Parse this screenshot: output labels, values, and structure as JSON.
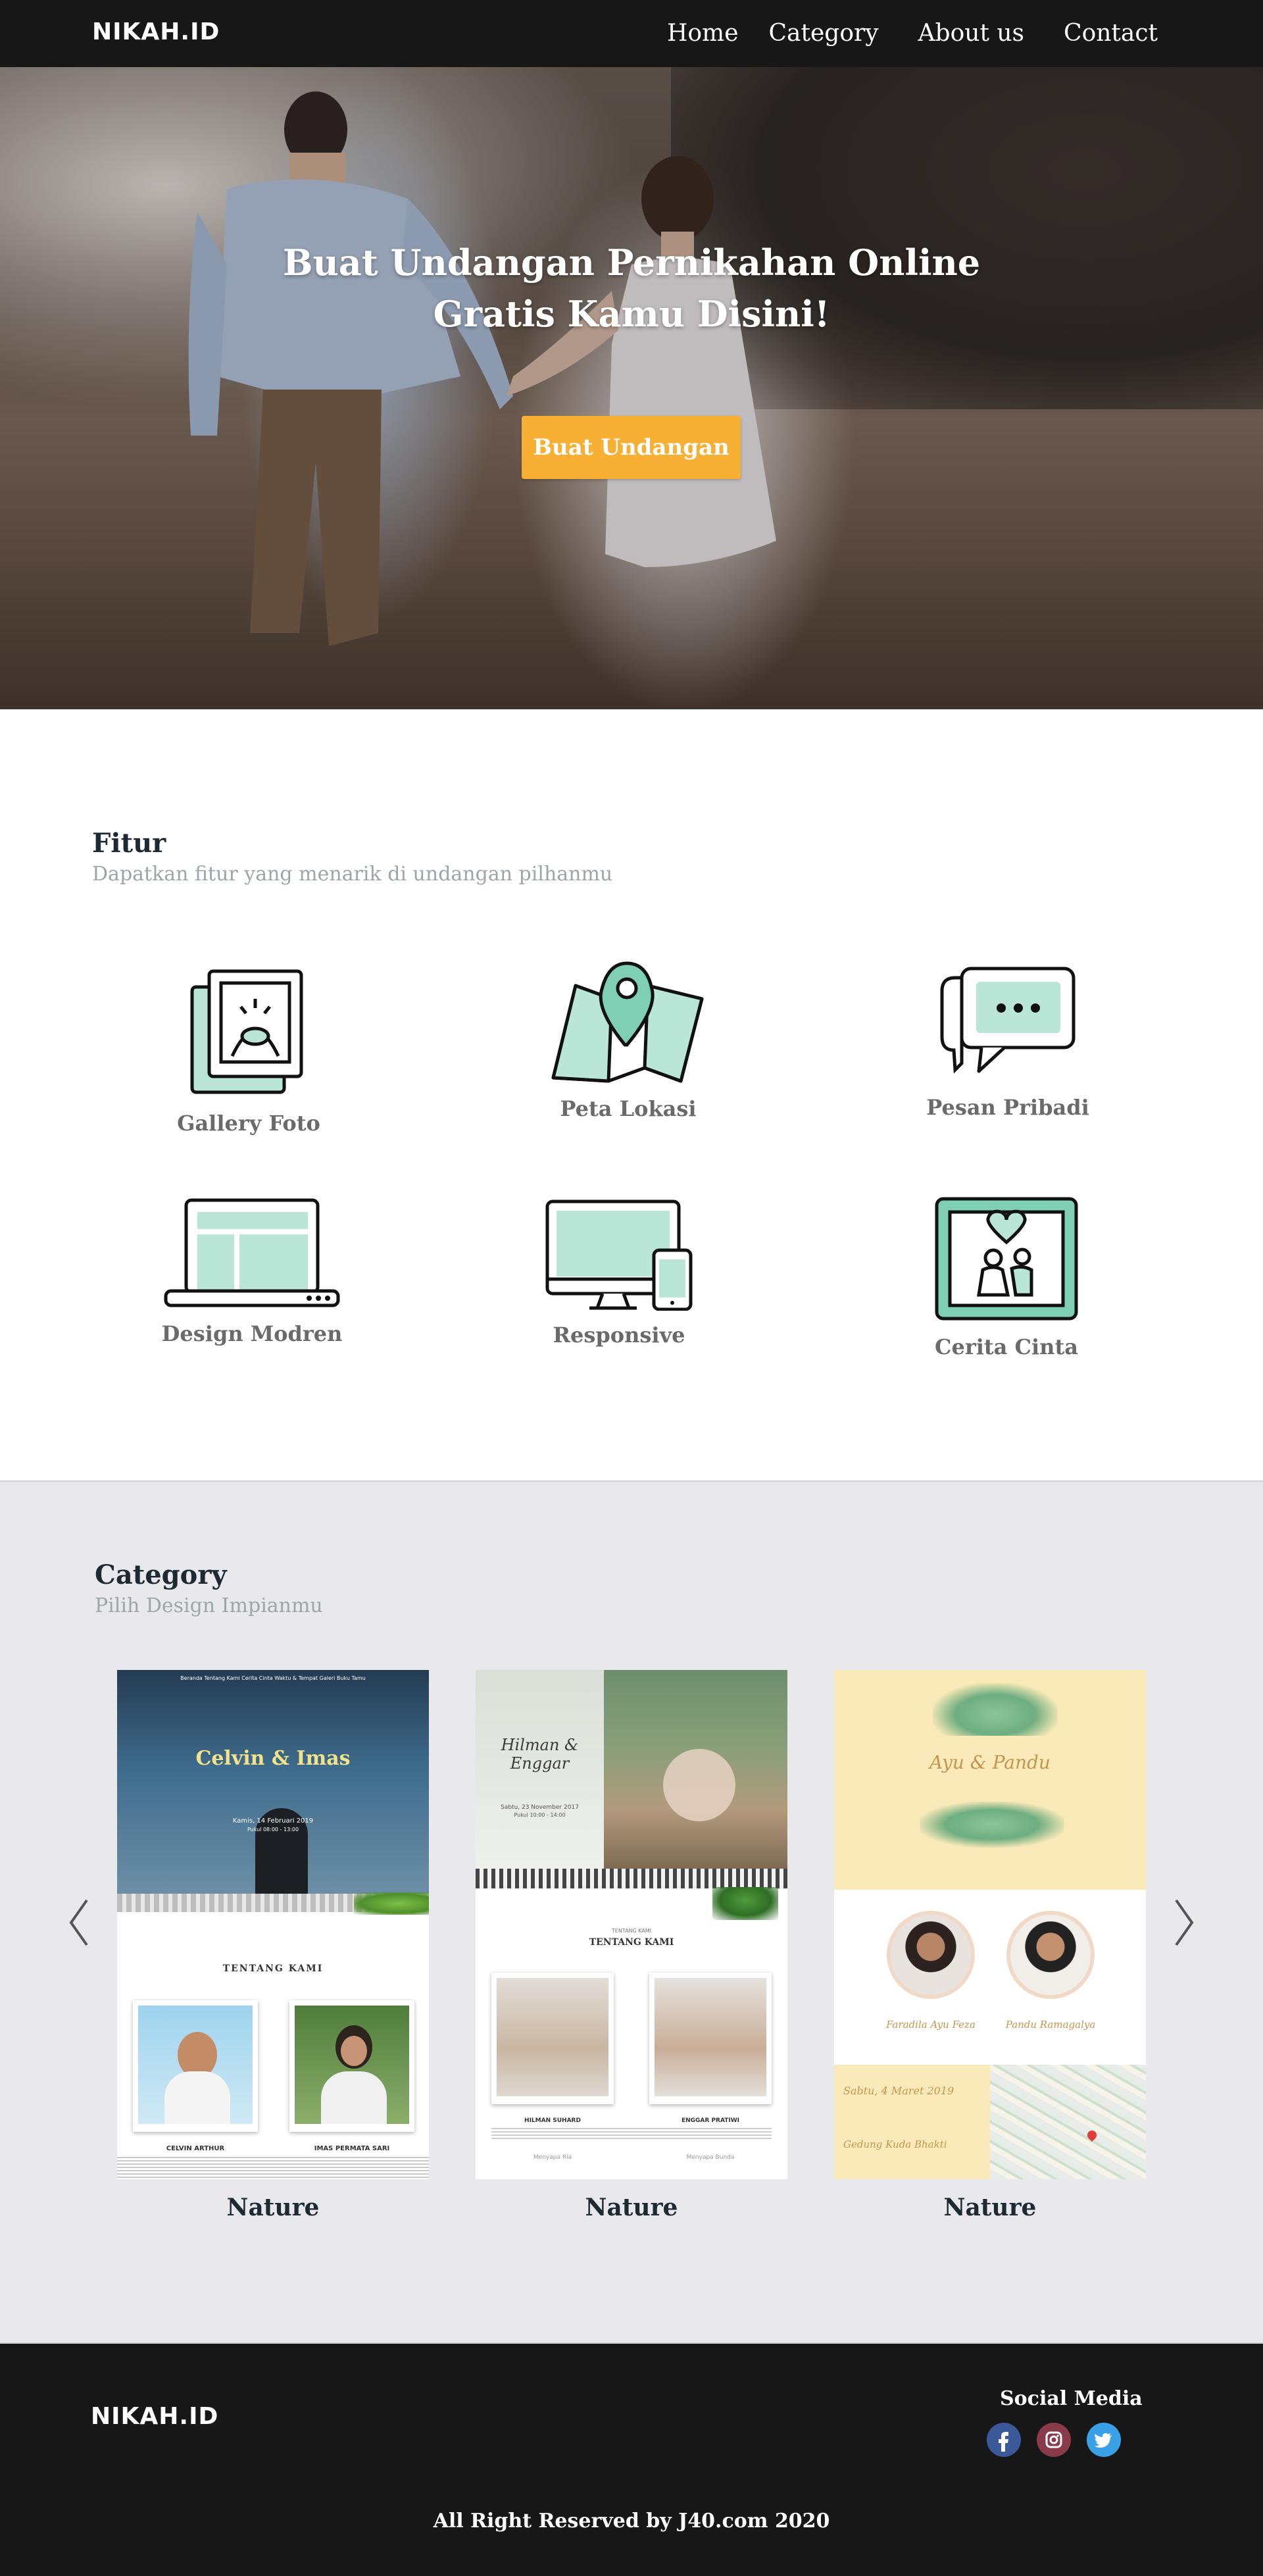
{
  "navbar": {
    "brand": "NIKAH.ID",
    "links": [
      "Home",
      "Category",
      "About us",
      "Contact"
    ]
  },
  "hero": {
    "title_line1": "Buat Undangan Pernikahan Online",
    "title_line2": "Gratis Kamu Disini!",
    "button": "Buat Undangan"
  },
  "fitur": {
    "title": "Fitur",
    "subtitle": "Dapatkan fitur yang menarik di undangan pilhanmu",
    "items": [
      {
        "label": "Gallery Foto",
        "icon": "gallery-photo-icon"
      },
      {
        "label": "Peta Lokasi",
        "icon": "map-location-icon"
      },
      {
        "label": "Pesan Pribadi",
        "icon": "chat-message-icon"
      },
      {
        "label": "Design Modren",
        "icon": "laptop-design-icon"
      },
      {
        "label": "Responsive",
        "icon": "devices-responsive-icon"
      },
      {
        "label": "Cerita Cinta",
        "icon": "love-story-icon"
      }
    ]
  },
  "category": {
    "title": "Category",
    "subtitle": "Pilih Design Impianmu",
    "cards": [
      {
        "label": "Nature",
        "nav": "Beranda   Tentang Kami   Cerita Cinta   Waktu & Tempat   Galeri   Buku Tamu",
        "names": "Celvin & Imas",
        "date": "Kamis, 14 Februari 2019",
        "time": "Pukul 08:00 - 13:00",
        "section": "TENTANG KAMI",
        "person1": "CELVIN ARTHUR",
        "person2": "IMAS PERMATA SARI"
      },
      {
        "label": "Nature",
        "names": "Hilman & Enggar",
        "date": "Sabtu, 23 November 2017",
        "time": "Pukul 10:00 - 14:00",
        "kicker": "TENTANG KAMI",
        "section": "TENTANG KAMI",
        "person1": "HILMAN SUHARD",
        "person2": "ENGGAR PRATIWI",
        "social1": "Menyapa Ria",
        "social2": "Menyapa Bunda"
      },
      {
        "label": "Nature",
        "names": "Ayu & Pandu",
        "date": "Sabtu, 4 Maret 2019",
        "venue": "Gedung Kuda Bhakti",
        "person1": "Faradila Ayu Feza",
        "person2": "Pandu Ramagalya"
      }
    ]
  },
  "footer": {
    "brand": "NIKAH.ID",
    "social_title": "Social Media",
    "social": [
      "facebook-icon",
      "instagram-icon",
      "twitter-icon"
    ],
    "copyright": "All Right Reserved by J40.com 2020"
  },
  "colors": {
    "dark": "#171717",
    "accent": "#f7b034",
    "mint": "#b9e6d6",
    "category_bg": "#e9e9ed"
  }
}
